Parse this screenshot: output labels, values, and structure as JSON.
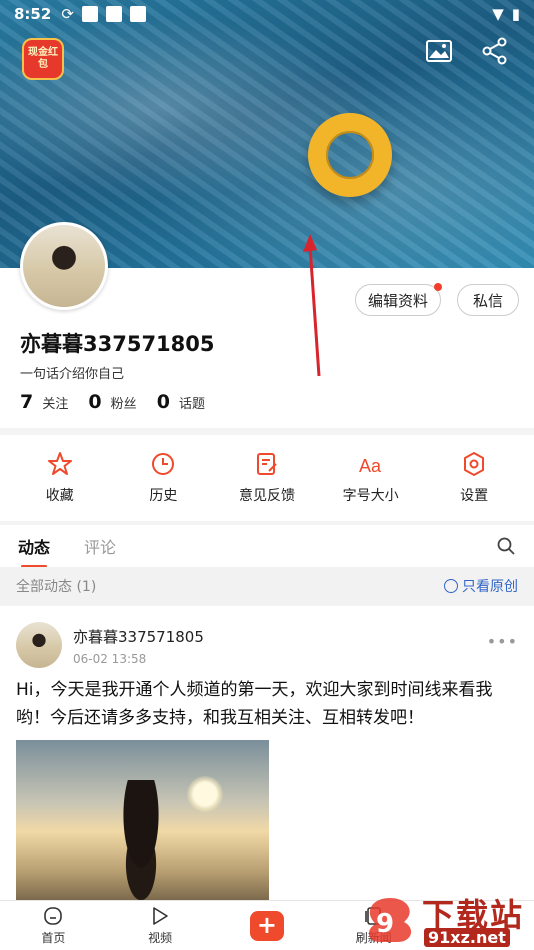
{
  "status_bar": {
    "time": "8:52"
  },
  "cover": {
    "red_packet": "现金红包",
    "icons": [
      "image-icon",
      "share-icon"
    ]
  },
  "profile": {
    "edit_button": "编辑资料",
    "message_button": "私信",
    "username": "亦暮暮337571805",
    "bio": "一句话介绍你自己",
    "stats": [
      {
        "count": "7",
        "label": "关注"
      },
      {
        "count": "0",
        "label": "粉丝"
      },
      {
        "count": "0",
        "label": "话题"
      }
    ]
  },
  "menu": [
    {
      "label": "收藏",
      "icon": "star-icon"
    },
    {
      "label": "历史",
      "icon": "clock-icon"
    },
    {
      "label": "意见反馈",
      "icon": "edit-note-icon"
    },
    {
      "label": "字号大小",
      "icon": "font-size-icon"
    },
    {
      "label": "设置",
      "icon": "settings-icon"
    }
  ],
  "tabs": [
    {
      "label": "动态",
      "active": true
    },
    {
      "label": "评论",
      "active": false
    }
  ],
  "filter": {
    "all_label": "全部动态 (1)",
    "original_label": "只看原创"
  },
  "post": {
    "author": "亦暮暮337571805",
    "time": "06-02 13:58",
    "text": "Hi，今天是我开通个人频道的第一天，欢迎大家到时间线来看我哟！今后还请多多支持，和我互相关注、互相转发吧！"
  },
  "bottom_nav": [
    {
      "label": "首页",
      "icon": "home-icon"
    },
    {
      "label": "视频",
      "icon": "play-icon"
    },
    {
      "label": "+",
      "icon": "plus-icon"
    },
    {
      "label": "刷新闻",
      "icon": "news-icon"
    }
  ],
  "watermark": {
    "top": "下载站",
    "bottom": "91xz.net"
  },
  "colors": {
    "accent": "#ee4a2b",
    "link": "#3266c8",
    "annotation": "#d8252d"
  }
}
